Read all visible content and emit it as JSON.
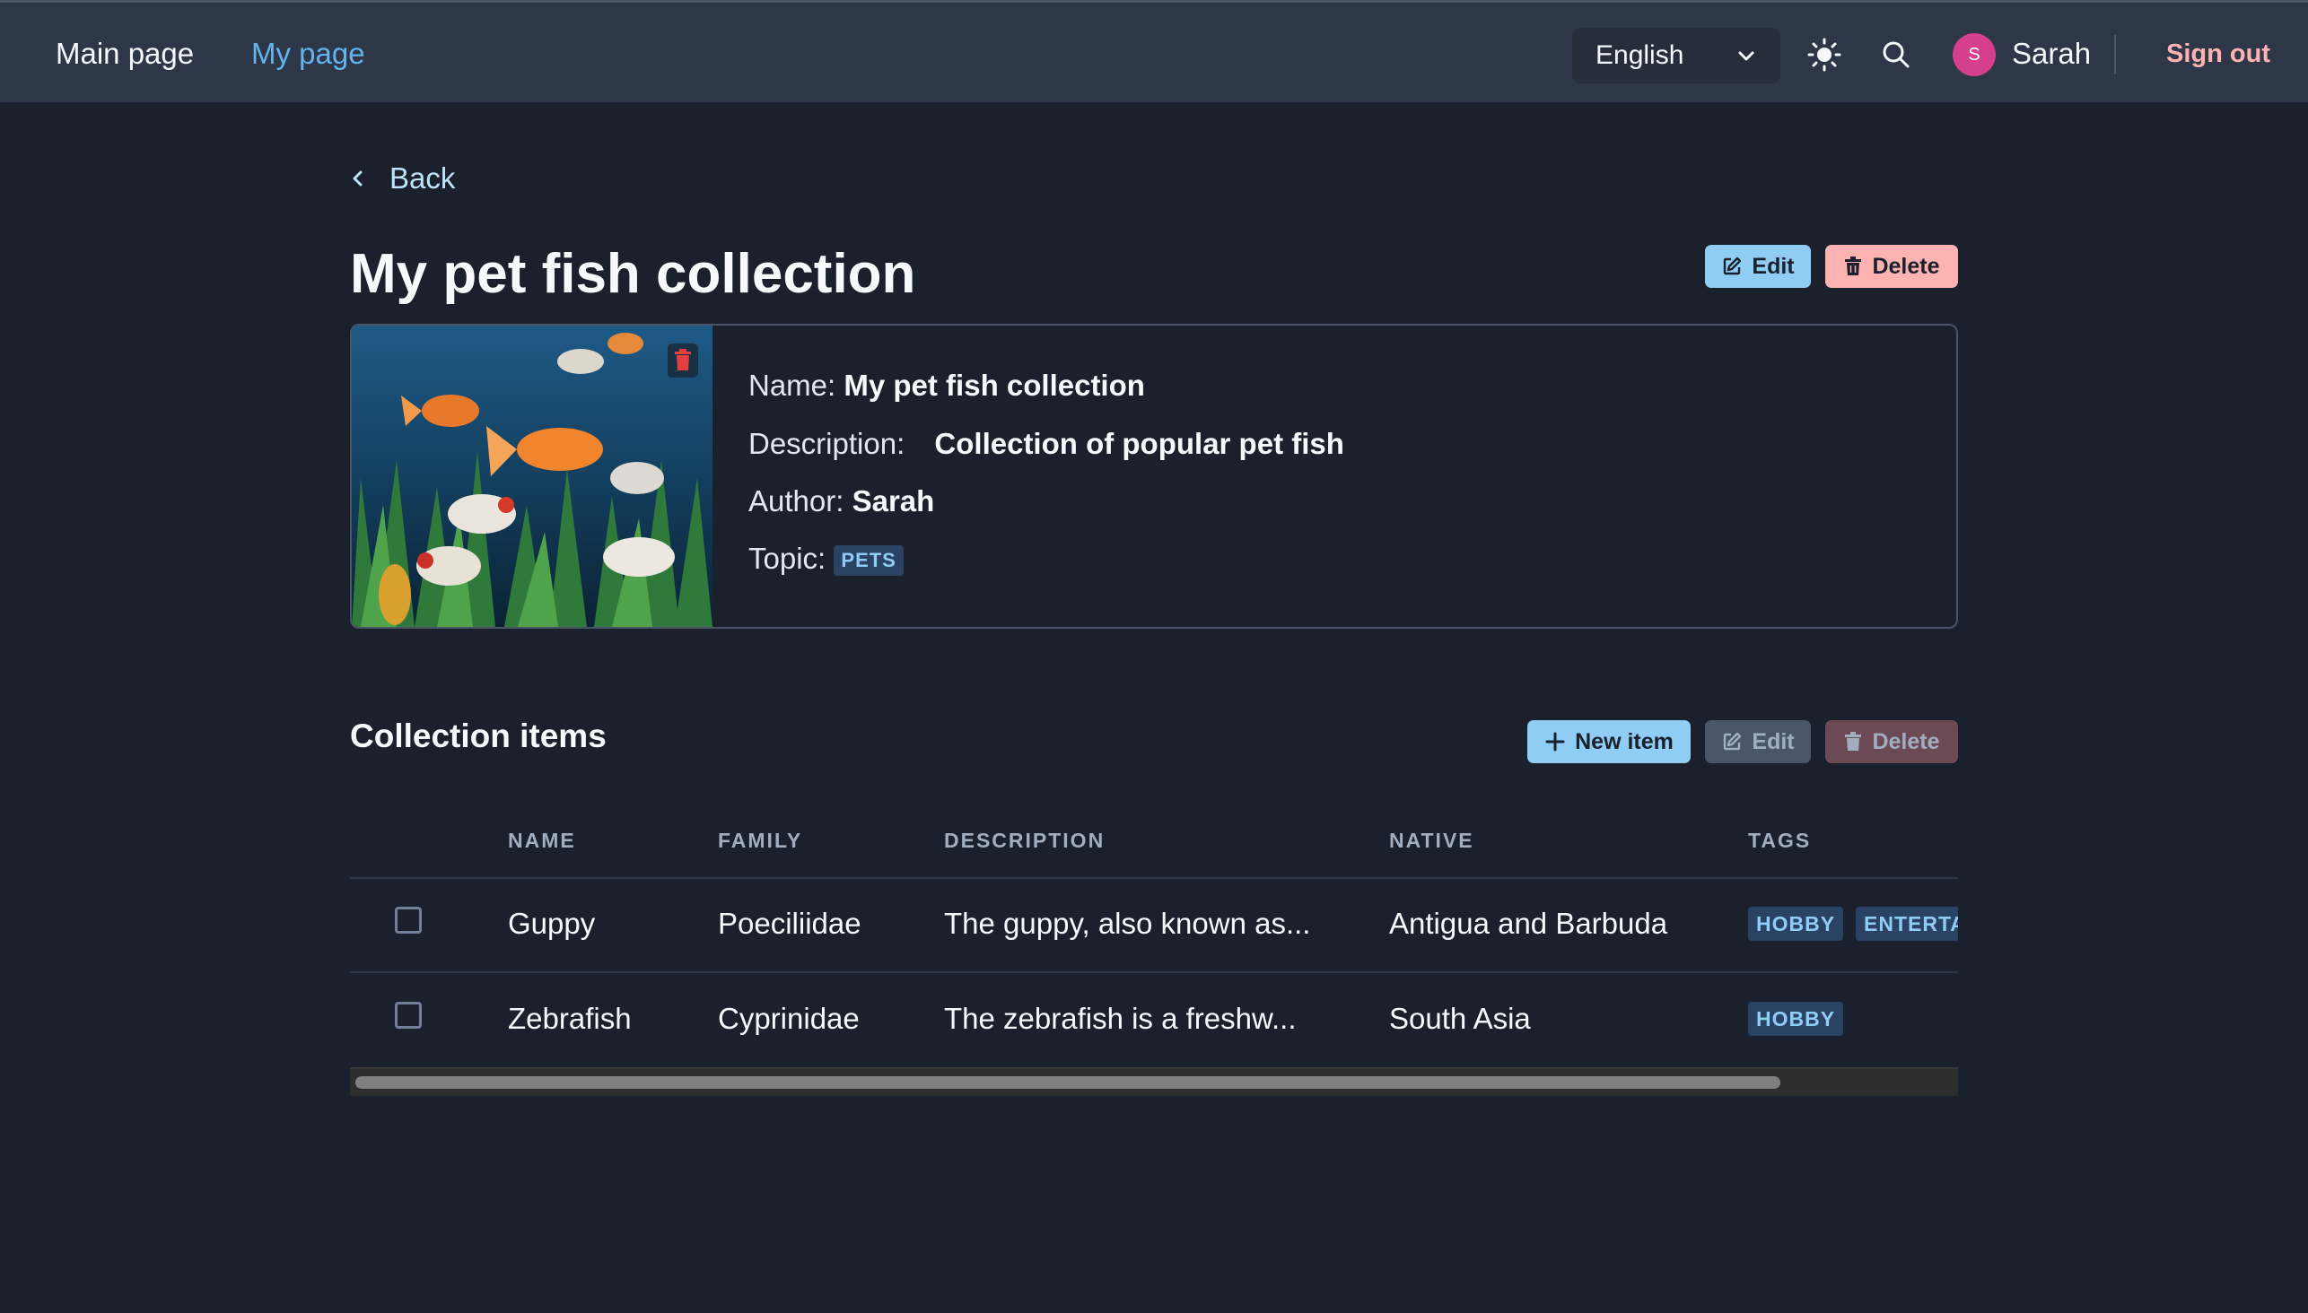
{
  "nav": {
    "main_page": "Main page",
    "my_page": "My page",
    "language": "English",
    "user_initial": "S",
    "user_name": "Sarah",
    "sign_out": "Sign out"
  },
  "back_label": "Back",
  "collection": {
    "title": "My pet fish collection",
    "edit_label": "Edit",
    "delete_label": "Delete",
    "name_label": "Name:",
    "name_value": "My pet fish collection",
    "description_label": "Description:",
    "description_value": "Collection of popular pet fish",
    "author_label": "Author:",
    "author_value": "Sarah",
    "topic_label": "Topic:",
    "topic_value": "PETS"
  },
  "items": {
    "title": "Collection items",
    "new_item_label": "New item",
    "edit_label": "Edit",
    "delete_label": "Delete",
    "columns": [
      "NAME",
      "FAMILY",
      "DESCRIPTION",
      "NATIVE",
      "TAGS"
    ],
    "rows": [
      {
        "name": "Guppy",
        "family": "Poeciliidae",
        "description": "The guppy, also known as...",
        "native": "Antigua and Barbuda",
        "tags": [
          "HOBBY",
          "ENTERTA"
        ]
      },
      {
        "name": "Zebrafish",
        "family": "Cyprinidae",
        "description": "The zebrafish is a freshw...",
        "native": "South Asia",
        "tags": [
          "HOBBY"
        ]
      }
    ]
  },
  "colors": {
    "background": "#1a202c",
    "topbar": "#2d3748",
    "accent_blue": "#63b3ed",
    "button_blue": "#90cdf4",
    "button_red": "#feb2b2",
    "avatar": "#d53f8c"
  },
  "icons": {
    "language_chevron": "chevron-down-icon",
    "theme": "sun-icon",
    "search": "search-icon",
    "back": "chevron-left-icon",
    "edit": "edit-icon",
    "delete": "trash-icon",
    "add": "plus-icon"
  }
}
